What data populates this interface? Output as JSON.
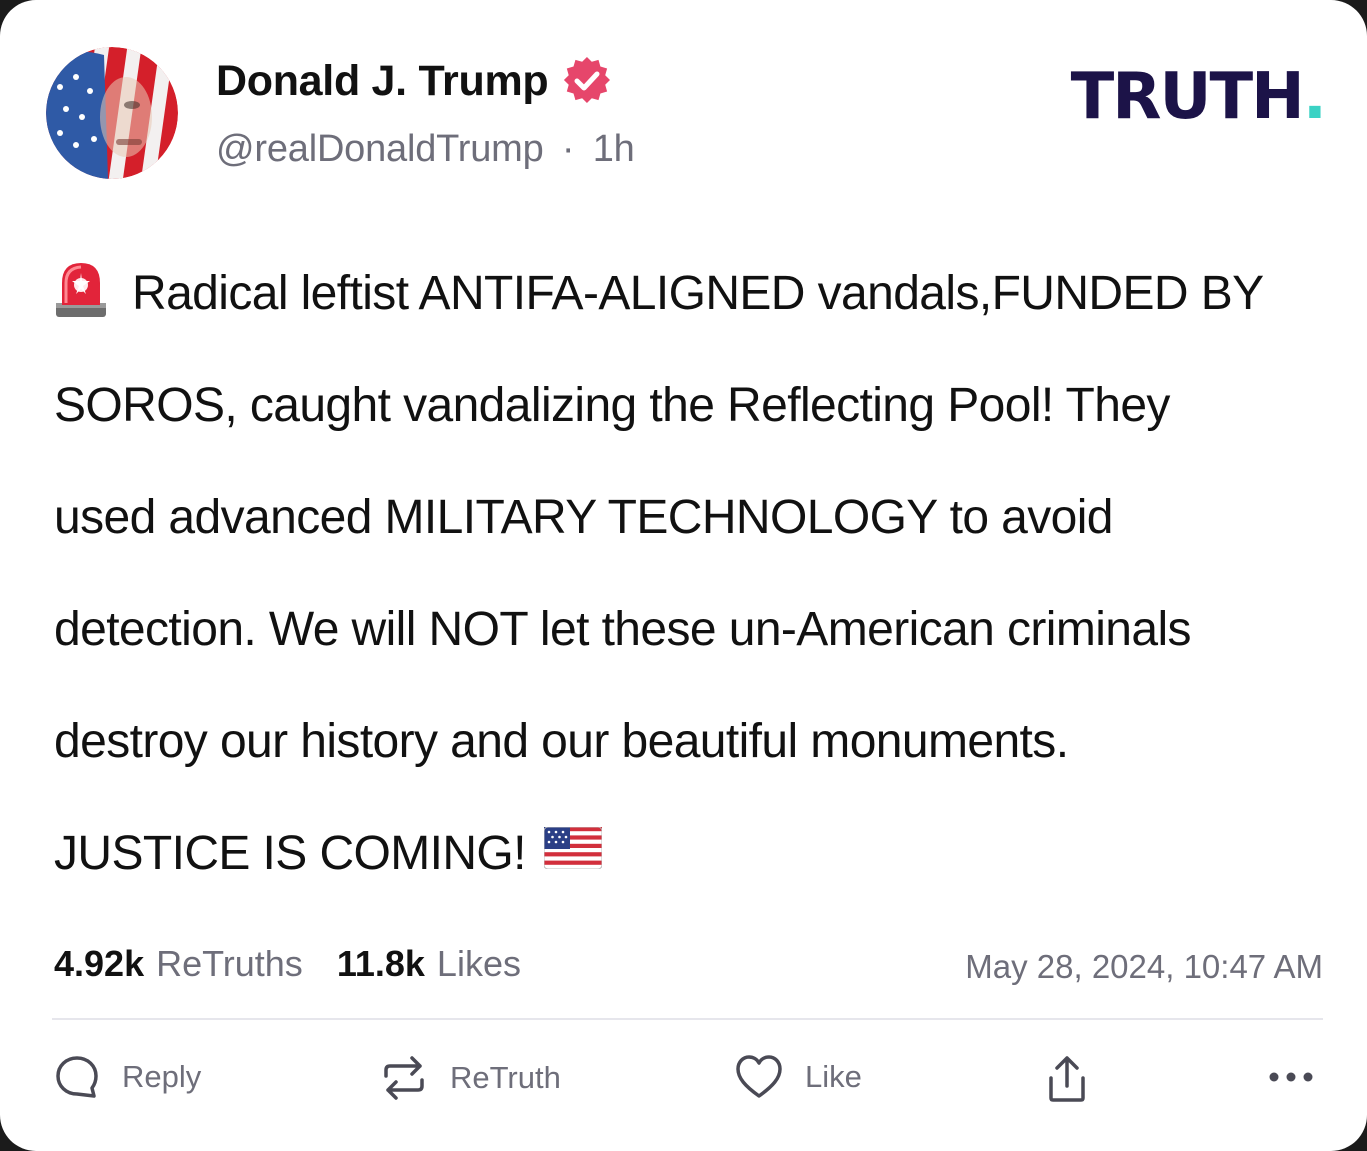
{
  "post": {
    "author_name": "Donald J. Trump",
    "handle": "@realDonaldTrump",
    "separator": "·",
    "relative_time": "1h",
    "body_lines": [
      "Radical leftist ANTIFA-ALIGNED vandals,FUNDED BY",
      "SOROS, caught vandalizing the Reflecting Pool! They",
      "used advanced MILITARY TECHNOLOGY to avoid",
      "detection. We will NOT let these un-American criminals",
      "destroy our history and our beautiful monuments.",
      "JUSTICE IS COMING!"
    ],
    "leading_emoji": "siren-icon",
    "trailing_emoji": "us-flag-icon"
  },
  "brand": {
    "logo_text": "TRUTH",
    "logo_dot": ".",
    "logo_color": "#1c1348",
    "accent_color": "#3ad2c4",
    "verified_color": "#e6466b"
  },
  "stats": {
    "retruths_count": "4.92k",
    "retruths_label": "ReTruths",
    "likes_count": "11.8k",
    "likes_label": "Likes",
    "timestamp": "May 28, 2024, 10:47 AM"
  },
  "actions": {
    "reply_label": "Reply",
    "retruth_label": "ReTruth",
    "like_label": "Like",
    "share_icon": "share-icon",
    "more_icon": "more-icon"
  }
}
